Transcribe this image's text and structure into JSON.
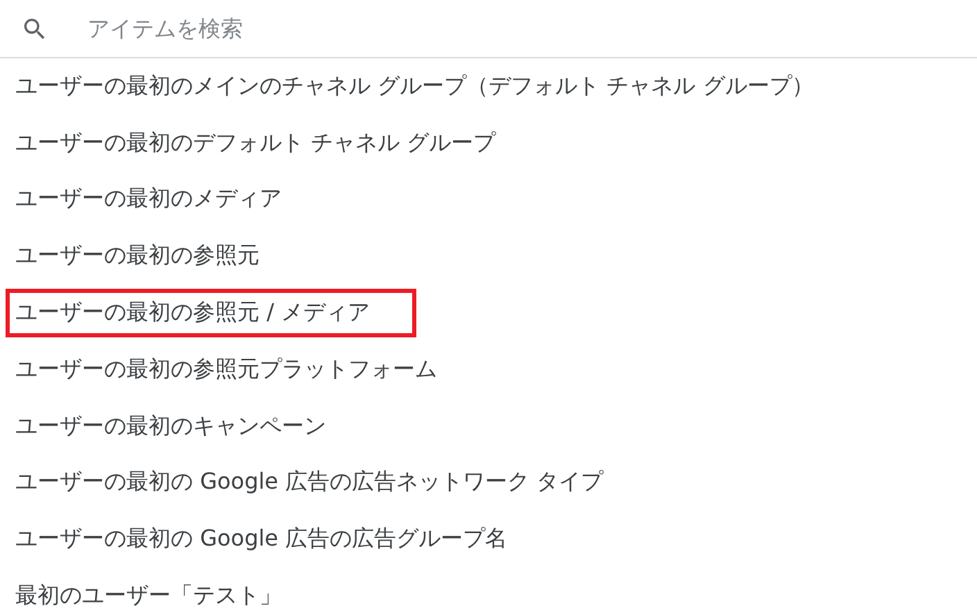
{
  "search": {
    "placeholder": "アイテムを検索"
  },
  "items": [
    {
      "label": "ユーザーの最初のメインのチャネル グループ（デフォルト チャネル グループ）",
      "highlighted": false
    },
    {
      "label": "ユーザーの最初のデフォルト チャネル グループ",
      "highlighted": false
    },
    {
      "label": "ユーザーの最初のメディア",
      "highlighted": false
    },
    {
      "label": "ユーザーの最初の参照元",
      "highlighted": false
    },
    {
      "label": "ユーザーの最初の参照元 / メディア",
      "highlighted": true
    },
    {
      "label": "ユーザーの最初の参照元プラットフォーム",
      "highlighted": false
    },
    {
      "label": "ユーザーの最初のキャンペーン",
      "highlighted": false
    },
    {
      "label": "ユーザーの最初の Google 広告の広告ネットワーク タイプ",
      "highlighted": false
    },
    {
      "label": "ユーザーの最初の Google 広告の広告グループ名",
      "highlighted": false
    },
    {
      "label": "最初のユーザー「テスト」",
      "highlighted": false
    }
  ]
}
